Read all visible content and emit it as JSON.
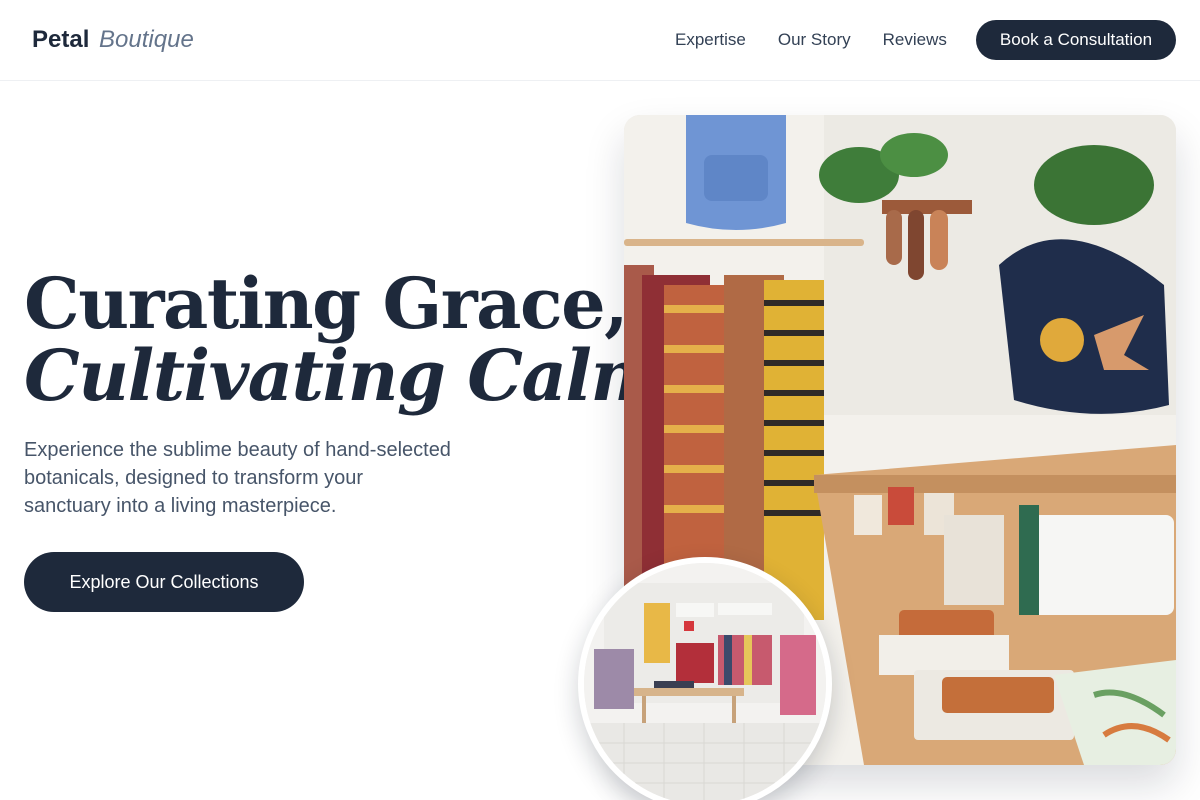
{
  "header": {
    "logo": {
      "brand": "Petal",
      "accent": "Boutique"
    },
    "nav": [
      {
        "label": "Expertise"
      },
      {
        "label": "Our Story"
      },
      {
        "label": "Reviews"
      }
    ],
    "cta_label": "Book a Consultation"
  },
  "hero": {
    "title_line1": "Curating Grace,",
    "title_line2": "Cultivating Calm.",
    "description": "Experience the sublime beauty of hand-selected botanicals, designed to transform your sanctuary into a living masterpiece.",
    "cta_label": "Explore Our Collections"
  },
  "colors": {
    "primary": "#1e293b",
    "text_muted": "#475569",
    "background": "#ffffff"
  }
}
